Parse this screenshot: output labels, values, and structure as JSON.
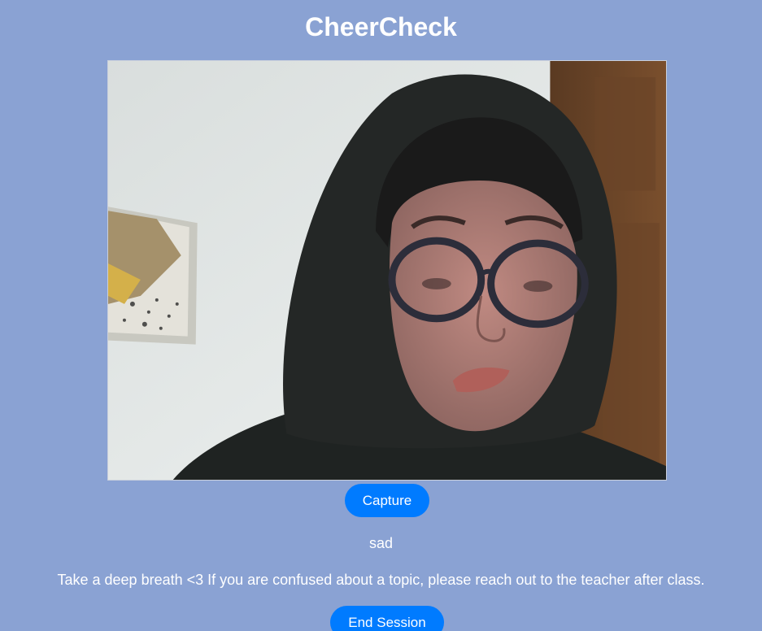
{
  "app": {
    "title": "CheerCheck"
  },
  "camera": {
    "feed_description_icon": "webcam-feed"
  },
  "controls": {
    "capture_label": "Capture",
    "end_session_label": "End Session"
  },
  "result": {
    "emotion": "sad",
    "message": "Take a deep breath <3 If you are confused about a topic, please reach out to the teacher after class."
  },
  "colors": {
    "background": "#8aa2d3",
    "button": "#007bff",
    "text": "#ffffff"
  }
}
